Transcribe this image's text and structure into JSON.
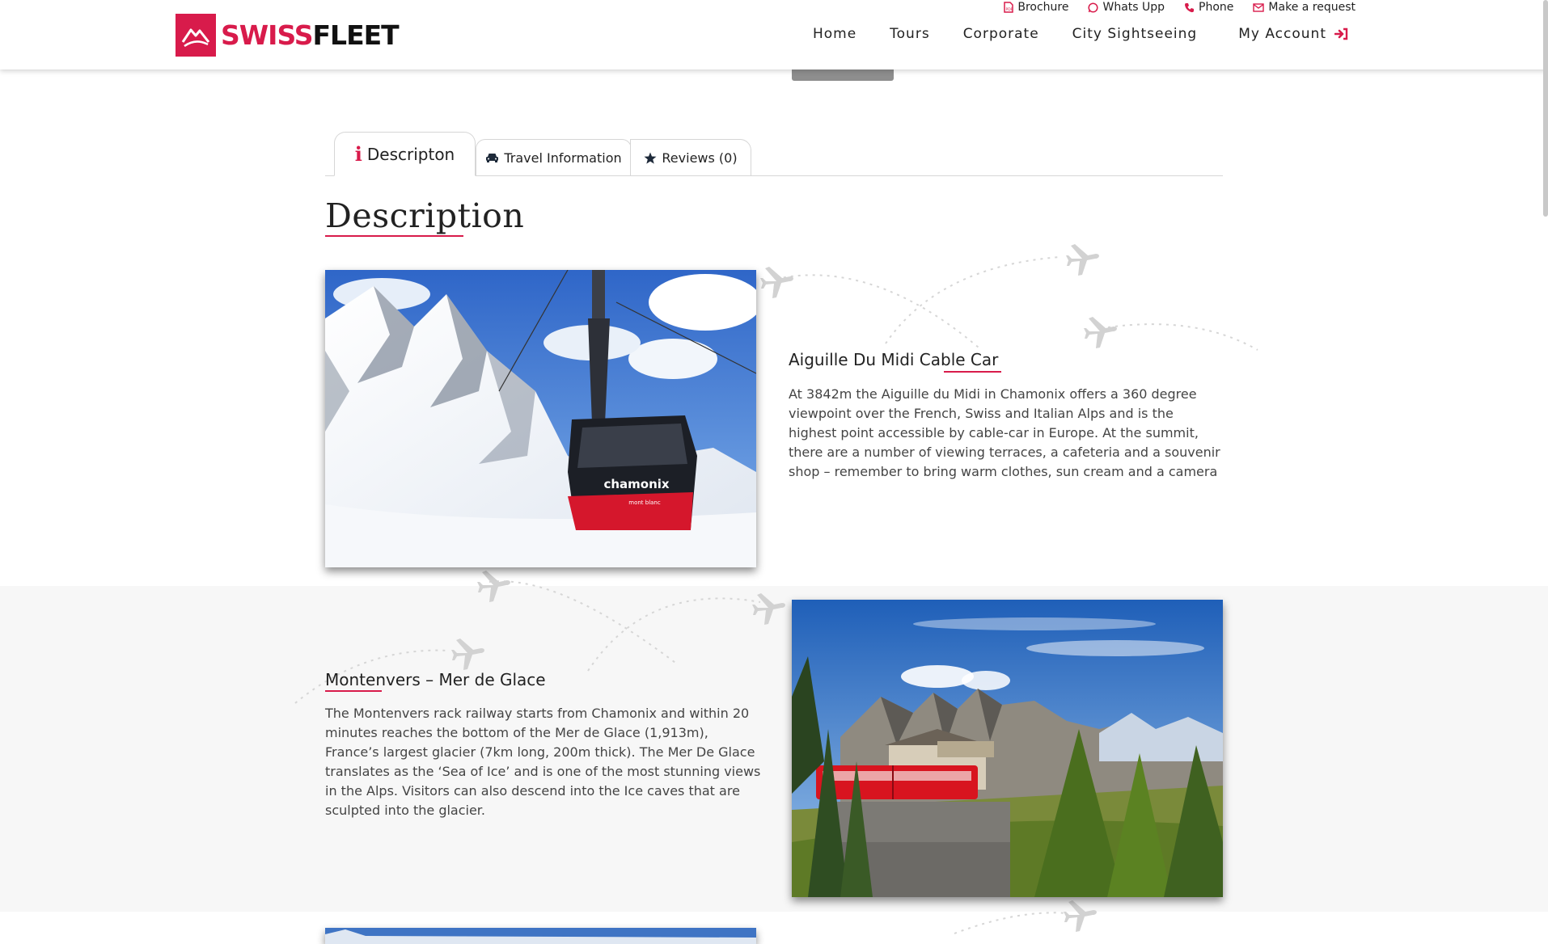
{
  "brand": {
    "name_part1": "SWISS",
    "name_part2": "FLEET",
    "color": "#d81b4b"
  },
  "toplinks": [
    {
      "label": "Brochure",
      "icon": "pdf-file-icon"
    },
    {
      "label": "Whats Upp",
      "icon": "whatsapp-icon"
    },
    {
      "label": "Phone",
      "icon": "phone-icon"
    },
    {
      "label": "Make a request",
      "icon": "envelope-icon"
    }
  ],
  "nav": {
    "home": "Home",
    "tours": "Tours",
    "corporate": "Corporate",
    "city": "City Sightseeing",
    "account": "My Account",
    "account_icon": "sign-in-icon"
  },
  "tabs": [
    {
      "label": "Descripton",
      "icon": "info-icon",
      "active": true
    },
    {
      "label": "Travel Information",
      "icon": "car-icon",
      "active": false
    },
    {
      "label": "Reviews (0)",
      "icon": "star-icon",
      "active": false
    }
  ],
  "section_title": "Description",
  "attractions": [
    {
      "title": "Aiguille Du Midi Cable Car",
      "text": "At 3842m the Aiguille du Midi in Chamonix offers a 360 degree viewpoint over the French, Swiss and Italian Alps and is the highest point accessible by cable-car in Europe. At the summit, there are a number of viewing terraces, a cafeteria and a souvenir shop – remember to bring warm clothes, sun cream and a camera",
      "image_label": "chamonix",
      "image_sublabel": "mont blanc"
    },
    {
      "title": "Montenvers – Mer de Glace",
      "text": "The Montenvers rack railway starts from Chamonix and within 20 minutes reaches the bottom of the Mer de Glace (1,913m), France’s largest glacier (7km long, 200m thick). The Mer De Glace translates as the ‘Sea of Ice’ and is one of the most stunning views in the Alps. Visitors can also descend into the Ice caves that are sculpted into the glacier."
    }
  ],
  "colors": {
    "accent": "#d81b4b",
    "band": "#f7f7f7",
    "plane": "#d2d2d2"
  }
}
